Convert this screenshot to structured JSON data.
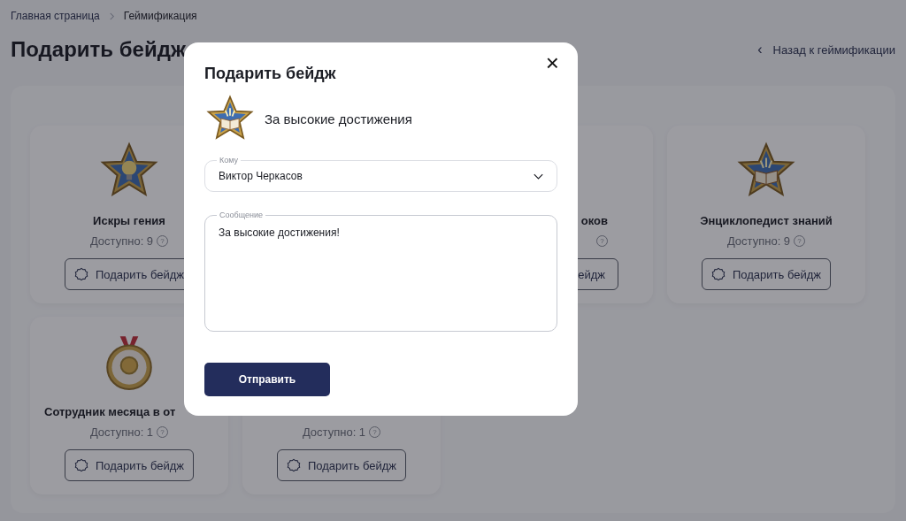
{
  "breadcrumbs": [
    {
      "label": "Главная страница",
      "current": false
    },
    {
      "label": "Геймификация",
      "current": true
    }
  ],
  "page_title": "Подарить бейдж",
  "back_link": {
    "icon": "‹",
    "label": "Назад к геймификации"
  },
  "cards": [
    {
      "kind": "star-bulb",
      "title": "Искры гения",
      "available": "Доступно: 9",
      "help": "?",
      "button": "Подарить бейдж"
    },
    {
      "title": "оков",
      "help": "?",
      "button": "ейдж"
    },
    {
      "kind": "star-book",
      "title": "Энциклопедист знаний",
      "available": "Доступно: 9",
      "help": "?",
      "button": "Подарить бейдж"
    },
    {
      "kind": "medal",
      "title": "Сотрудник месяца в от",
      "available": "Доступно: 1",
      "help": "?",
      "button": "Подарить бейдж"
    },
    {
      "available": "Доступно: 1",
      "help": "?",
      "button": "Подарить бейдж"
    }
  ],
  "modal": {
    "title": "Подарить бейдж",
    "close": "×",
    "badge": {
      "kind": "star-book",
      "name": "За высокие достижения"
    },
    "recipient": {
      "label": "Кому",
      "value": "Виктор Черкасов"
    },
    "message": {
      "label": "Сообщение",
      "value": "За высокие достижения!"
    },
    "submit": "Отправить"
  }
}
